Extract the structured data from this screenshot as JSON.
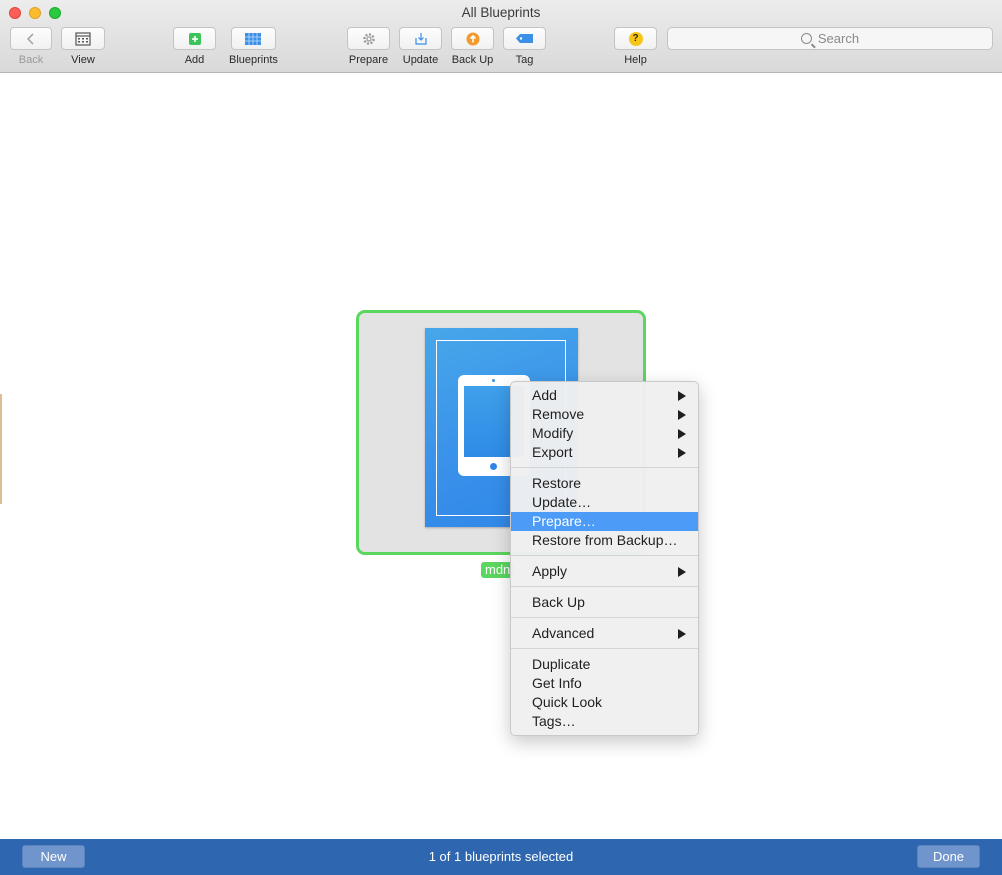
{
  "window": {
    "title": "All Blueprints"
  },
  "toolbar": {
    "back": "Back",
    "view": "View",
    "add": "Add",
    "blueprints": "Blueprints",
    "prepare": "Prepare",
    "update": "Update",
    "back_up": "Back Up",
    "tag": "Tag",
    "help": "Help",
    "help_glyph": "?",
    "search_placeholder": "Search"
  },
  "blueprint": {
    "name": "mdn",
    "selected": true,
    "device": "ipad"
  },
  "context_menu": {
    "groups": [
      [
        {
          "label": "Add",
          "submenu": true
        },
        {
          "label": "Remove",
          "submenu": true
        },
        {
          "label": "Modify",
          "submenu": true
        },
        {
          "label": "Export",
          "submenu": true
        }
      ],
      [
        {
          "label": "Restore"
        },
        {
          "label": "Update…"
        },
        {
          "label": "Prepare…",
          "highlighted": true
        },
        {
          "label": "Restore from Backup…"
        }
      ],
      [
        {
          "label": "Apply",
          "submenu": true
        }
      ],
      [
        {
          "label": "Back Up"
        }
      ],
      [
        {
          "label": "Advanced",
          "submenu": true
        }
      ],
      [
        {
          "label": "Duplicate"
        },
        {
          "label": "Get Info"
        },
        {
          "label": "Quick Look"
        },
        {
          "label": "Tags…"
        }
      ]
    ]
  },
  "bottom_bar": {
    "new_label": "New",
    "status": "1 of 1 blueprints selected",
    "done_label": "Done"
  },
  "colors": {
    "accent": "#4b9bf7",
    "selection": "#5bd65f",
    "bottom_bar": "#2f66b0"
  }
}
